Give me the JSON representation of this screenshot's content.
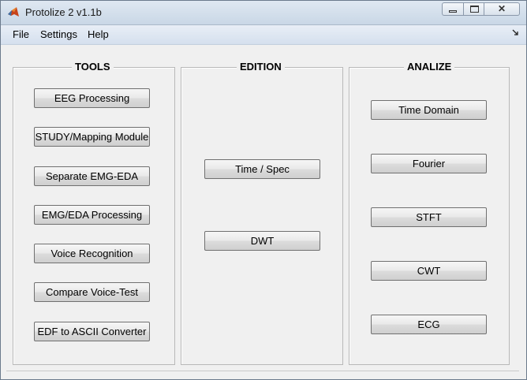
{
  "window": {
    "title": "Protolize 2 v1.1b",
    "close_symbol": "✕"
  },
  "menu": {
    "items": [
      "File",
      "Settings",
      "Help"
    ]
  },
  "panels": {
    "tools": {
      "title": "TOOLS",
      "buttons": [
        "EEG Processing",
        "STUDY/Mapping Module",
        "Separate EMG-EDA",
        "EMG/EDA Processing",
        "Voice Recognition",
        "Compare Voice-Test",
        "EDF to ASCII Converter"
      ]
    },
    "edition": {
      "title": "EDITION",
      "buttons": [
        "Time / Spec",
        "DWT"
      ]
    },
    "analize": {
      "title": "ANALIZE",
      "buttons": [
        "Time Domain",
        "Fourier",
        "STFT",
        "CWT",
        "ECG"
      ]
    }
  }
}
